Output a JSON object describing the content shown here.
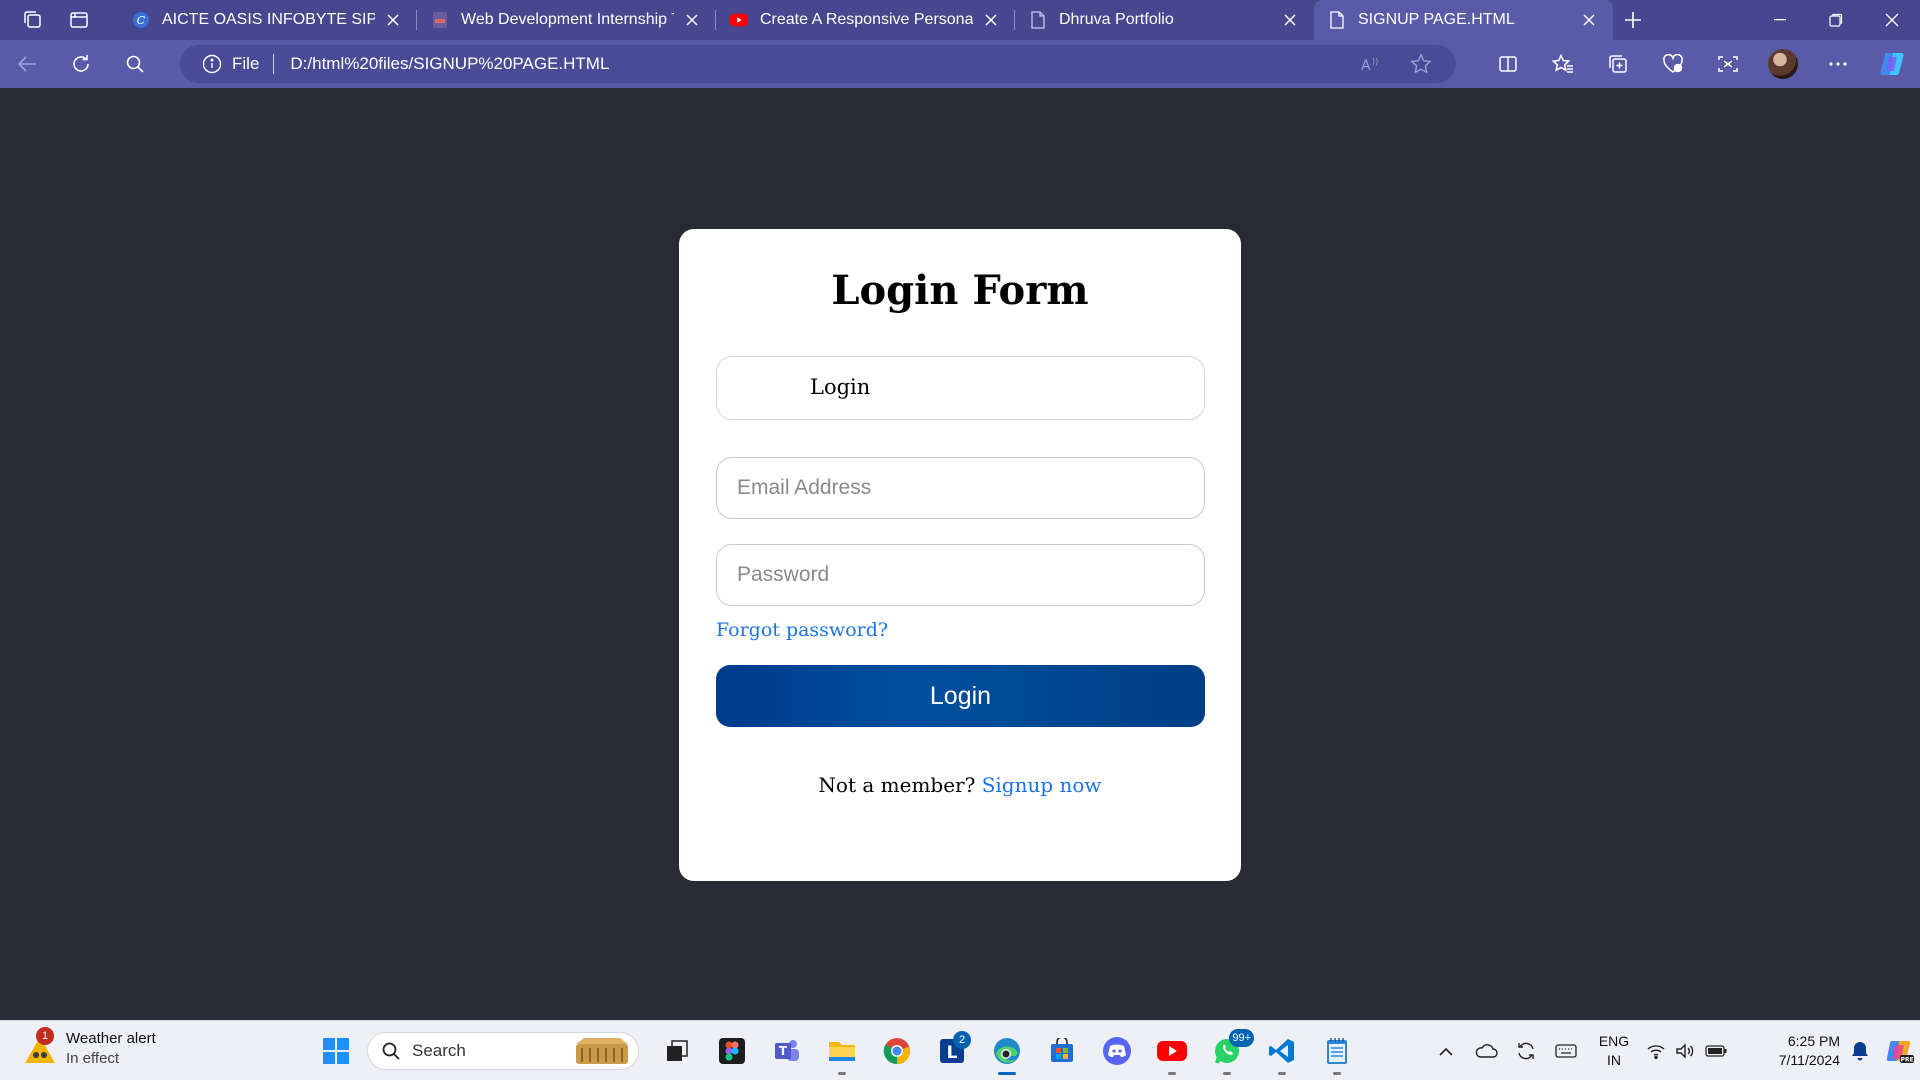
{
  "browser": {
    "tabs": [
      {
        "title": "AICTE OASIS INFOBYTE SIP TASK"
      },
      {
        "title": "Web Development Internship Tas"
      },
      {
        "title": "Create A Responsive Personal PC"
      },
      {
        "title": "Dhruva Portfolio"
      },
      {
        "title": "SIGNUP PAGE.HTML"
      }
    ],
    "address": {
      "scheme_label": "File",
      "url": "D:/html%20files/SIGNUP%20PAGE.HTML"
    }
  },
  "login": {
    "title": "Login Form",
    "toggle_label": "Login",
    "email_placeholder": "Email Address",
    "password_placeholder": "Password",
    "forgot_link": "Forgot password?",
    "submit_label": "Login",
    "signup_prompt": "Not a member?",
    "signup_link": "Signup now"
  },
  "taskbar": {
    "weather_title": "Weather alert",
    "weather_sub": "In effect",
    "weather_badge": "1",
    "search_label": "Search",
    "linkedin_badge": "2",
    "whatsapp_badge": "99+",
    "lang_top": "ENG",
    "lang_bottom": "IN",
    "time": "6:25 PM",
    "date": "7/11/2024"
  },
  "colors": {
    "tabstrip_bg": "#46478e",
    "toolbar_bg": "#5a5ba8",
    "page_bg": "#282a36",
    "link": "#1a73e8",
    "button": "#004f9e"
  }
}
